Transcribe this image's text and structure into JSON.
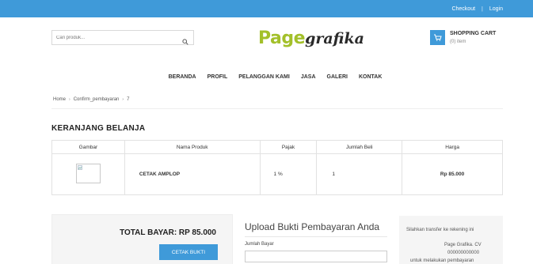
{
  "topbar": {
    "checkout": "Checkout",
    "separator": "|",
    "login": "Login"
  },
  "search": {
    "placeholder": "Cari produk..."
  },
  "logo": {
    "part1": "Page",
    "part2": "grafika"
  },
  "cart": {
    "title": "SHOPPING CART",
    "items": "(0) item"
  },
  "nav": {
    "items": [
      "BERANDA",
      "PROFIL",
      "PELANGGAN KAMI",
      "JASA",
      "GALERI",
      "KONTAK"
    ]
  },
  "breadcrumb": {
    "home": "Home",
    "arrow": "›",
    "page": "Confirm_pembayaran",
    "current": "7"
  },
  "heading": "KERANJANG BELANJA",
  "table": {
    "headers": [
      "Gambar",
      "Nama Produk",
      "Pajak",
      "Jumlah Beli",
      "Harga"
    ],
    "rows": [
      {
        "name": "CETAK AMPLOP",
        "tax": "1 %",
        "qty": "1",
        "price": "Rp 85.000"
      }
    ]
  },
  "total": {
    "label": "TOTAL BAYAR:  RP 85.000",
    "button": "CETAK BUKTI"
  },
  "upload": {
    "title": "Upload Bukti Pembayaran Anda",
    "field_label": "Jumlah Bayar",
    "field_value": ""
  },
  "transfer": {
    "line1": "Silahkan transfer ke rekening ini",
    "line2": "Page Grafika. CV",
    "line3": "000000000000",
    "line4": "untuk melakukan pembayaran"
  },
  "colors": {
    "accent": "#3f9ad9",
    "logo_green": "#a3c02a"
  }
}
